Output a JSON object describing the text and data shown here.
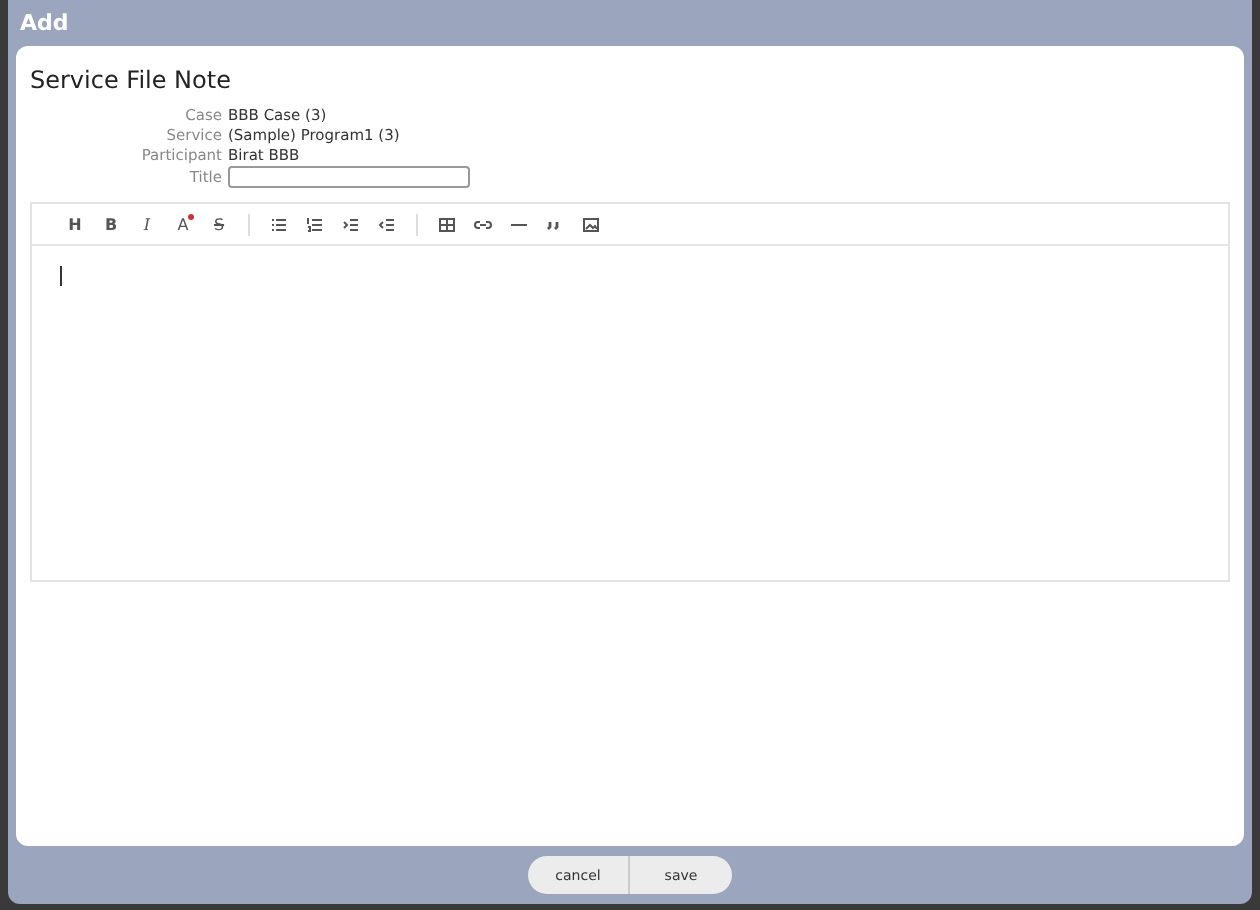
{
  "window": {
    "title": "Add"
  },
  "form": {
    "heading": "Service File Note",
    "fields": [
      {
        "kind": "text",
        "label": "Case",
        "value": "BBB Case (3)"
      },
      {
        "kind": "text",
        "label": "Service",
        "value": "(Sample) Program1 (3)"
      },
      {
        "kind": "text",
        "label": "Participant",
        "value": "Birat BBB"
      },
      {
        "kind": "input",
        "label": "Title"
      }
    ]
  },
  "editor": {
    "toolbar": [
      {
        "kind": "heading",
        "label": "H"
      },
      {
        "kind": "bold",
        "label": "B"
      },
      {
        "kind": "italic",
        "label": "I"
      },
      {
        "kind": "color",
        "label": "A"
      },
      {
        "kind": "strike",
        "label": "S"
      },
      {
        "kind": "separator"
      },
      {
        "kind": "bullet-list"
      },
      {
        "kind": "numbered-list"
      },
      {
        "kind": "indent"
      },
      {
        "kind": "outdent"
      },
      {
        "kind": "separator"
      },
      {
        "kind": "table"
      },
      {
        "kind": "link"
      },
      {
        "kind": "rule"
      },
      {
        "kind": "quote"
      },
      {
        "kind": "image"
      }
    ]
  },
  "buttons": [
    "cancel",
    "save"
  ]
}
